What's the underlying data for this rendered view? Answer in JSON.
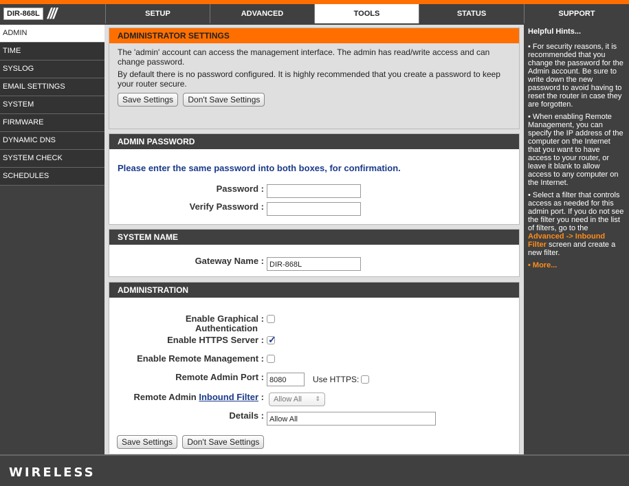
{
  "header": {
    "model": "DIR-868L",
    "tabs": [
      {
        "label": "SETUP"
      },
      {
        "label": "ADVANCED"
      },
      {
        "label": "TOOLS"
      },
      {
        "label": "STATUS"
      },
      {
        "label": "SUPPORT"
      }
    ],
    "active_tab": "TOOLS"
  },
  "sidebar": {
    "items": [
      {
        "label": "ADMIN"
      },
      {
        "label": "TIME"
      },
      {
        "label": "SYSLOG"
      },
      {
        "label": "EMAIL SETTINGS"
      },
      {
        "label": "SYSTEM"
      },
      {
        "label": "FIRMWARE"
      },
      {
        "label": "DYNAMIC DNS"
      },
      {
        "label": "SYSTEM CHECK"
      },
      {
        "label": "SCHEDULES"
      }
    ],
    "active": "ADMIN"
  },
  "admin_settings": {
    "title": "ADMINISTRATOR SETTINGS",
    "para1": "The 'admin' account can access the management interface. The admin has read/write access and can change password.",
    "para2": "By default there is no password configured. It is highly recommended that you create a password to keep your router secure.",
    "save_label": "Save Settings",
    "dont_save_label": "Don't Save Settings"
  },
  "admin_password": {
    "title": "ADMIN PASSWORD",
    "instruction": "Please enter the same password into both boxes, for confirmation.",
    "password_label": "Password :",
    "password_value": "",
    "verify_label": "Verify Password :",
    "verify_value": ""
  },
  "system_name": {
    "title": "SYSTEM NAME",
    "gateway_label": "Gateway Name :",
    "gateway_value": "DIR-868L"
  },
  "administration": {
    "title": "ADMINISTRATION",
    "graphical_auth_label_1": "Enable Graphical :",
    "graphical_auth_label_2": "Authentication",
    "graphical_auth_checked": false,
    "https_label": "Enable HTTPS Server :",
    "https_checked": true,
    "remote_mgmt_label": "Enable Remote Management :",
    "remote_mgmt_checked": false,
    "remote_port_label": "Remote Admin Port :",
    "remote_port_value": "8080",
    "use_https_label": "Use HTTPS:",
    "use_https_checked": false,
    "inbound_label_prefix": "Remote Admin",
    "inbound_label_link": "Inbound Filter",
    "inbound_label_suffix": ":",
    "inbound_selected": "Allow All",
    "details_label": "Details :",
    "details_value": "Allow All"
  },
  "bottom_buttons": {
    "save_label": "Save Settings",
    "dont_save_label": "Don't Save Settings"
  },
  "hints": {
    "title": "Helpful Hints...",
    "hint1": "• For security reasons, it is recommended that you change the password for the Admin account. Be sure to write down the new password to avoid having to reset the router in case they are forgotten.",
    "hint2": "• When enabling Remote Management, you can specify the IP address of the computer on the Internet that you want to have access to your router, or leave it blank to allow access to any computer on the Internet.",
    "hint3_pre": "• Select a filter that controls access as needed for this admin port. If you do not see the filter you need in the list of filters, go to the",
    "hint3_link": "Advanced -> Inbound Filter",
    "hint3_post": "screen and create a new filter.",
    "more": "• More..."
  },
  "footer": {
    "brand": "WIRELESS"
  },
  "colors": {
    "accent": "#ff6f00",
    "dark": "#404040",
    "link": "#1a3a8a"
  }
}
